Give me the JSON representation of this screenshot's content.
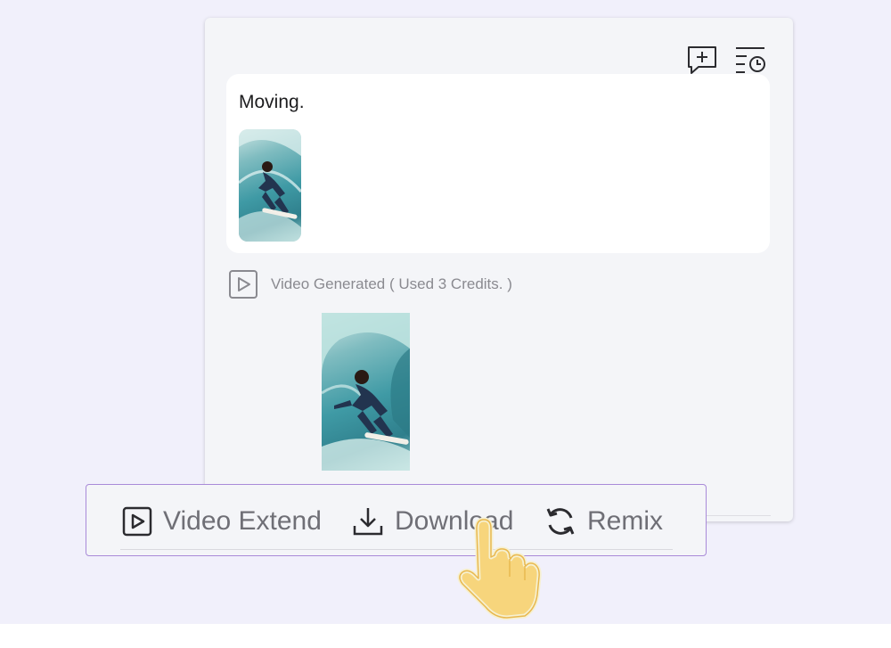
{
  "header": {
    "new_chat_icon": "chat-plus-icon",
    "history_icon": "history-list-icon"
  },
  "message": {
    "text": "Moving.",
    "attachment_icon": "surfer-image-thumbnail"
  },
  "result": {
    "status_text": "Video Generated ( Used 3 Credits. )",
    "status_icon": "video-play-icon"
  },
  "toolbar": {
    "video_extend_label": "Video Extend",
    "download_label": "Download",
    "remix_label": "Remix"
  },
  "colors": {
    "page_background": "#f1f0fb",
    "panel_background": "#f4f5f8",
    "toolbar_border": "#a98ad8",
    "cursor_fill": "#f7d57c",
    "cursor_stroke": "#f6f0d0",
    "muted_text": "#8a8a90"
  }
}
